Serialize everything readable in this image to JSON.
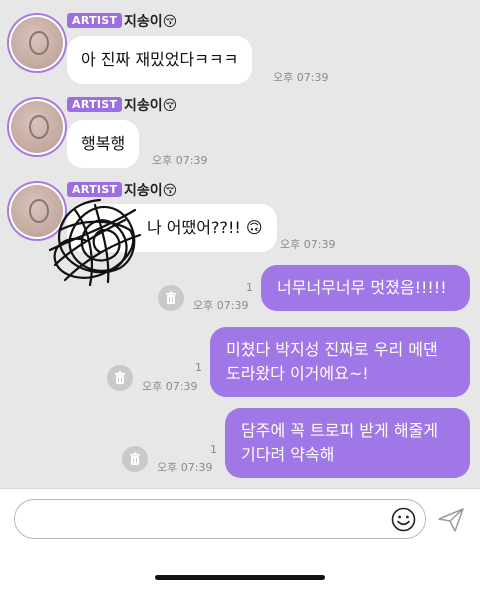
{
  "messages": [
    {
      "role": "artist",
      "badge": "ARTIST",
      "name": "지송이",
      "emoji": "😚",
      "text": "아 진짜 재밌었다ㅋㅋㅋ",
      "time": "오후 07:39"
    },
    {
      "role": "artist",
      "badge": "ARTIST",
      "name": "지송이",
      "emoji": "😚",
      "text": "행복행",
      "time": "오후 07:39"
    },
    {
      "role": "artist",
      "badge": "ARTIST",
      "name": "지송이",
      "emoji": "😚",
      "text": "나 어땠어??!!",
      "trailing_emoji": "🙃",
      "time": "오후 07:39"
    },
    {
      "role": "me",
      "lines": [
        "너무너무너무 멋졌음!!!!!"
      ],
      "time": "오후 07:39",
      "unread": "1"
    },
    {
      "role": "me",
      "lines": [
        "미쳤다 박지성 진짜로 우리 메댄",
        "도라왔다 이거에요~!"
      ],
      "time": "오후 07:39",
      "unread": "1"
    },
    {
      "role": "me",
      "lines": [
        "담주에 꼭 트로피 받게 해줄게",
        "기다려 약속해"
      ],
      "time": "오후 07:39",
      "unread": "1"
    }
  ],
  "composer": {
    "value": "",
    "emoji_icon": "smiley-icon",
    "send_icon": "paper-plane-icon"
  },
  "colors": {
    "accent": "#9f77e6",
    "background": "#e7e7e7",
    "incoming": "#ffffff"
  }
}
